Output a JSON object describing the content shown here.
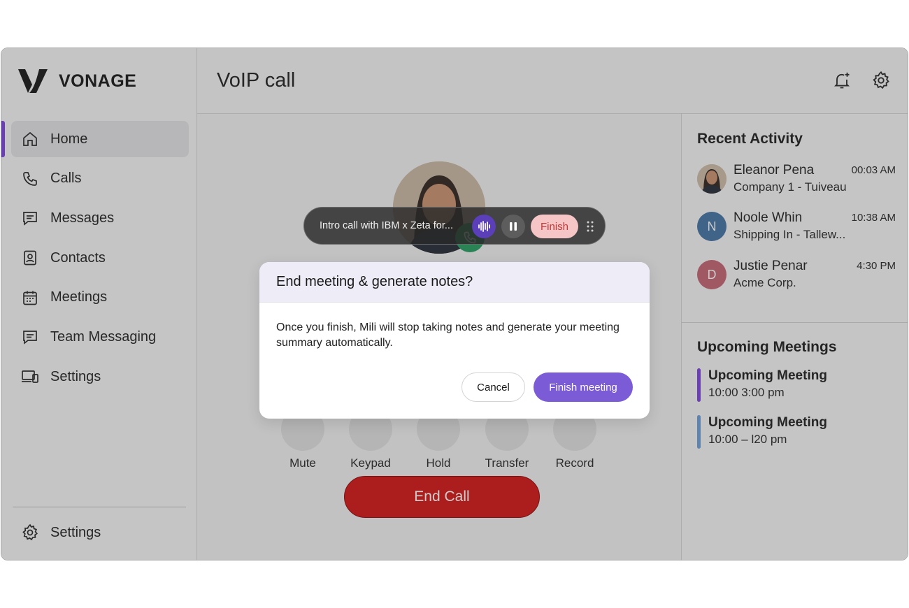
{
  "app": {
    "brand": "VONAGE",
    "page_title": "VoIP call"
  },
  "sidebar": {
    "items": [
      {
        "label": "Home",
        "icon": "home-icon",
        "active": true
      },
      {
        "label": "Calls",
        "icon": "phone-icon"
      },
      {
        "label": "Messages",
        "icon": "message-icon"
      },
      {
        "label": "Contacts",
        "icon": "contact-icon"
      },
      {
        "label": "Meetings",
        "icon": "calendar-icon"
      },
      {
        "label": "Team Messaging",
        "icon": "team-message-icon"
      },
      {
        "label": "Settings",
        "icon": "devices-icon"
      }
    ],
    "bottom_label": "Settings"
  },
  "call": {
    "controls": [
      "Mute",
      "Keypad",
      "Hold",
      "Transfer",
      "Record"
    ],
    "end_label": "End Call"
  },
  "recorder": {
    "title": "Intro call with IBM x Zeta for...",
    "finish_label": "Finish"
  },
  "dialog": {
    "title": "End meeting & generate notes?",
    "body": "Once you finish, Mili will stop taking notes and generate your meeting summary automatically.",
    "cancel_label": "Cancel",
    "confirm_label": "Finish meeting"
  },
  "recent_activity": {
    "title": "Recent Activity",
    "items": [
      {
        "name": "Eleanor Pena",
        "sub": "Company 1 - Tuiveau",
        "time": "00:03 AM",
        "initial": ""
      },
      {
        "name": "Noole Whin",
        "sub": "Shipping In - Tallew...",
        "time": "10:38 AM",
        "initial": "N",
        "color": "#3f6fa3"
      },
      {
        "name": "Justie Penar",
        "sub": "Acme Corp.",
        "time": "4:30 PM",
        "initial": "D",
        "color": "#c4606f"
      }
    ]
  },
  "upcoming_meetings": {
    "title": "Upcoming Meetings",
    "items": [
      {
        "title": "Upcoming Meeting",
        "time": "10:00 3:00 pm",
        "color": "#7a3ee0"
      },
      {
        "title": "Upcoming Meeting",
        "time": "10:00 – l20 pm",
        "color": "#6a9bd8"
      }
    ]
  },
  "colors": {
    "accent": "#7a3ee0",
    "danger": "#d41010",
    "confirm": "#7c5cd6"
  }
}
